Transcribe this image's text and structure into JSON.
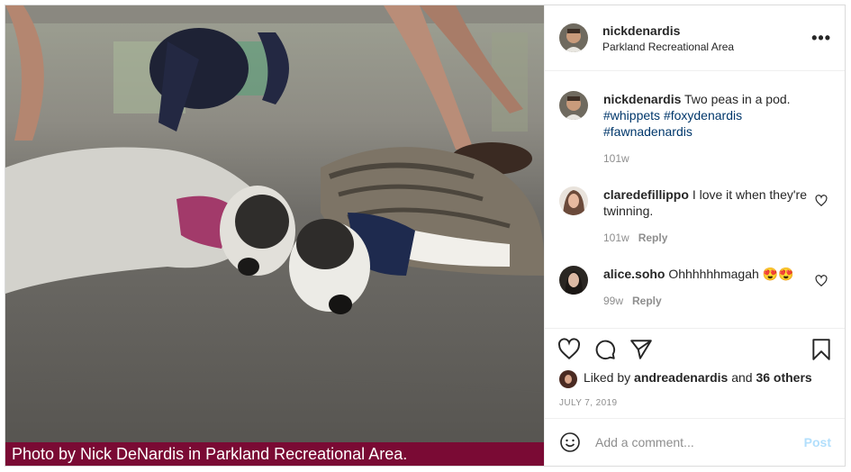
{
  "photo": {
    "caption": "Photo by Nick DeNardis in Parkland Recreational Area."
  },
  "header": {
    "username": "nickdenardis",
    "location": "Parkland Recreational Area",
    "more_icon": "more-options-icon"
  },
  "post_caption": {
    "username": "nickdenardis",
    "text": "Two peas in a pod.",
    "hashtags": [
      "#whippets",
      "#foxydenardis",
      "#fawnadenardis"
    ],
    "time": "101w"
  },
  "comments": [
    {
      "username": "claredefillippo",
      "text": "I love it when they're twinning.",
      "time": "101w",
      "reply_label": "Reply"
    },
    {
      "username": "alice.soho",
      "text": "Ohhhhhhmagah 😍😍",
      "time": "99w",
      "reply_label": "Reply"
    }
  ],
  "likes": {
    "prefix": "Liked by",
    "user": "andreadenardis",
    "and_label": "and",
    "others": "36 others"
  },
  "date": "JULY 7, 2019",
  "add_comment": {
    "placeholder": "Add a comment...",
    "post_label": "Post"
  }
}
